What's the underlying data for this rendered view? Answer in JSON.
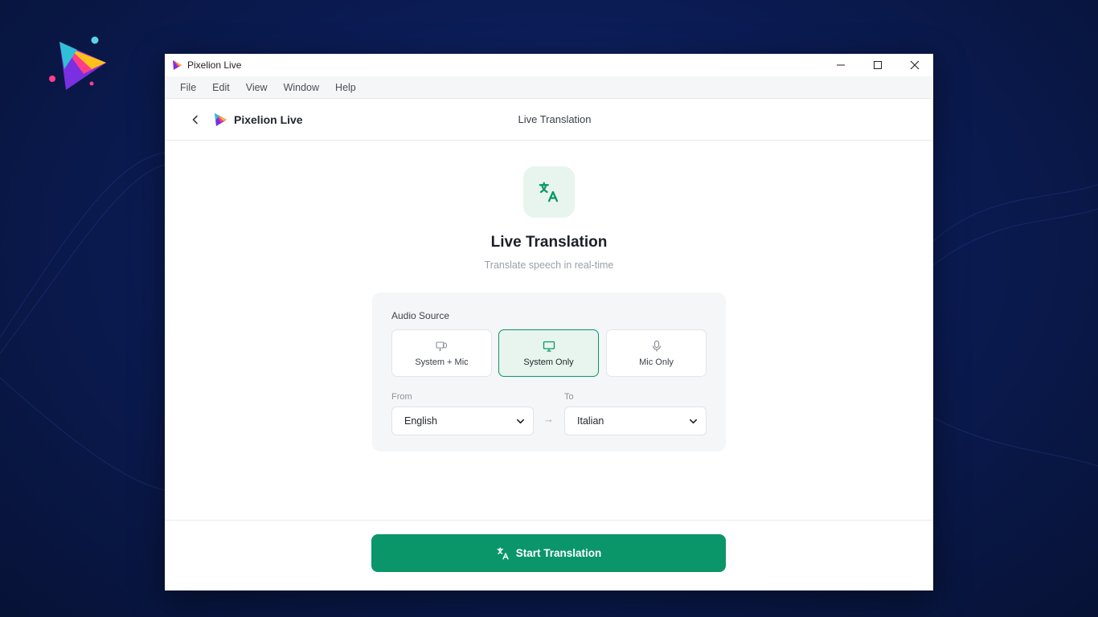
{
  "window": {
    "title": "Pixelion Live",
    "controls": [
      "minimize-icon",
      "maximize-icon",
      "close-icon"
    ]
  },
  "menu": [
    "File",
    "Edit",
    "View",
    "Window",
    "Help"
  ],
  "header": {
    "brand": "Pixelion Live",
    "page_title": "Live Translation"
  },
  "hero": {
    "icon": "translate-icon",
    "title": "Live Translation",
    "subtitle": "Translate speech in real-time"
  },
  "audio_source": {
    "label": "Audio Source",
    "options": [
      {
        "label": "System + Mic",
        "icon": "system-mic-icon",
        "selected": false
      },
      {
        "label": "System Only",
        "icon": "monitor-icon",
        "selected": true
      },
      {
        "label": "Mic Only",
        "icon": "microphone-icon",
        "selected": false
      }
    ]
  },
  "languages": {
    "from_label": "From",
    "from_value": "English",
    "to_label": "To",
    "to_value": "Italian",
    "separator": "→"
  },
  "start_button": {
    "label": "Start Translation",
    "icon": "translate-icon"
  },
  "colors": {
    "accent": "#0a9668",
    "accent_light": "#e8f5ee",
    "background": "#0b1c55"
  }
}
